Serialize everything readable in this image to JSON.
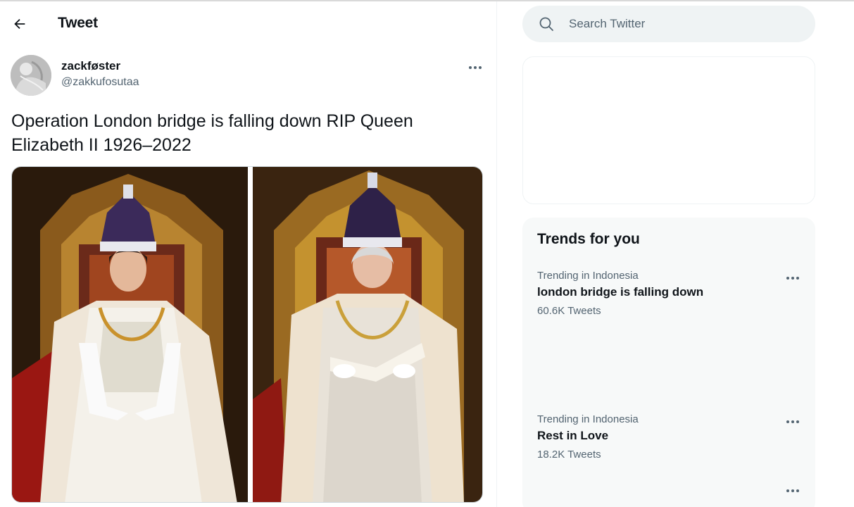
{
  "header": {
    "title": "Tweet",
    "back_icon": "arrow-left-icon"
  },
  "tweet": {
    "display_name": "zackføster",
    "handle": "@zakkufosutaa",
    "text": "Operation London bridge is falling down RIP Queen Elizabeth II 1926–2022",
    "more_icon": "more-horizontal-icon",
    "media_count": 2
  },
  "search": {
    "placeholder": "Search Twitter",
    "icon": "search-icon"
  },
  "trends": {
    "title": "Trends for you",
    "items": [
      {
        "context": "Trending in Indonesia",
        "name": "london bridge is falling down",
        "count": "60.6K Tweets"
      },
      {
        "context": "Trending in Indonesia",
        "name": "Rest in Love",
        "count": "18.2K Tweets"
      }
    ]
  },
  "colors": {
    "text_primary": "#0f1419",
    "text_secondary": "#536471",
    "search_bg": "#eff3f4",
    "trends_bg": "#f7f9f9",
    "border": "#eff3f4"
  }
}
